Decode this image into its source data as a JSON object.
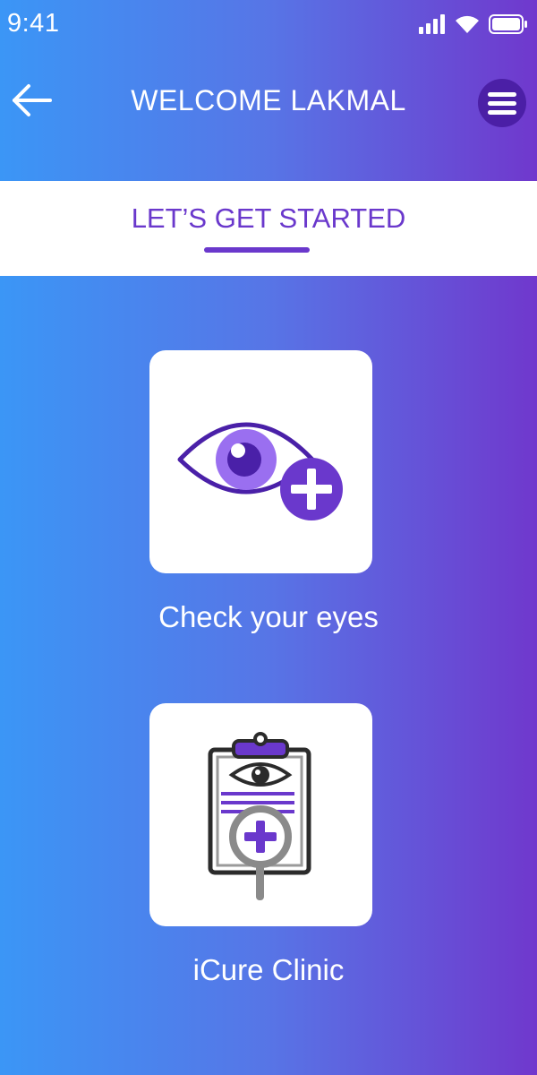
{
  "status_bar": {
    "time": "9:41",
    "icons": [
      "signal-icon",
      "wifi-icon",
      "battery-icon"
    ]
  },
  "header": {
    "title": "WELCOME LAKMAL",
    "back_icon": "back-arrow-icon",
    "menu_icon": "hamburger-menu-icon"
  },
  "tabs": [
    {
      "label": "LET’S GET STARTED",
      "active": true
    }
  ],
  "options": [
    {
      "label": "Check your eyes",
      "icon": "eye-plus-icon"
    },
    {
      "label": "iCure Clinic",
      "icon": "clinic-clipboard-icon"
    }
  ],
  "colors": {
    "gradient_start": "#3b96f6",
    "gradient_end": "#7038cd",
    "accent": "#6a38cc",
    "menu_button": "#4b1fa6"
  }
}
